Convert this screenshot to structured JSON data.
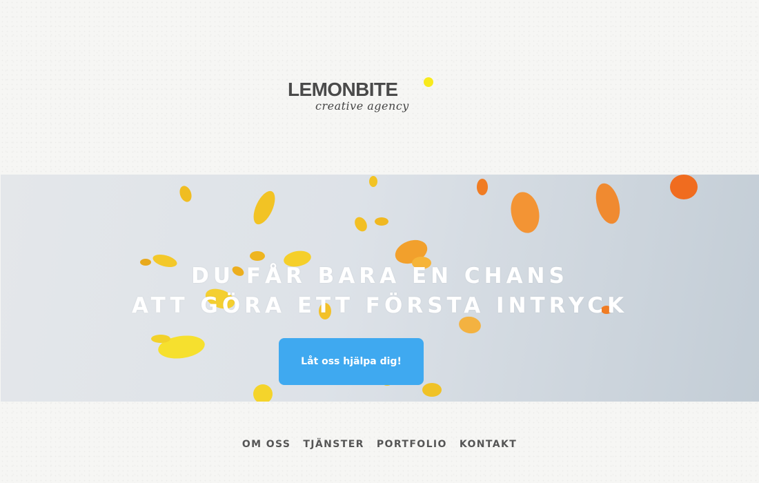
{
  "brand": {
    "name": "LEMONBITE",
    "tagline": "creative agency",
    "dot_color": "#f8ea1d"
  },
  "hero": {
    "headline_line1": "DU FÅR BARA EN CHANS",
    "headline_line2": "ATT GÖRA ETT FÖRSTA INTRYCK",
    "cta_label": "Låt oss hjälpa dig!",
    "cta_color": "#3fa9f0"
  },
  "nav": {
    "items": [
      {
        "label": "OM OSS"
      },
      {
        "label": "TJÄNSTER"
      },
      {
        "label": "PORTFOLIO"
      },
      {
        "label": "KONTAKT"
      }
    ]
  }
}
